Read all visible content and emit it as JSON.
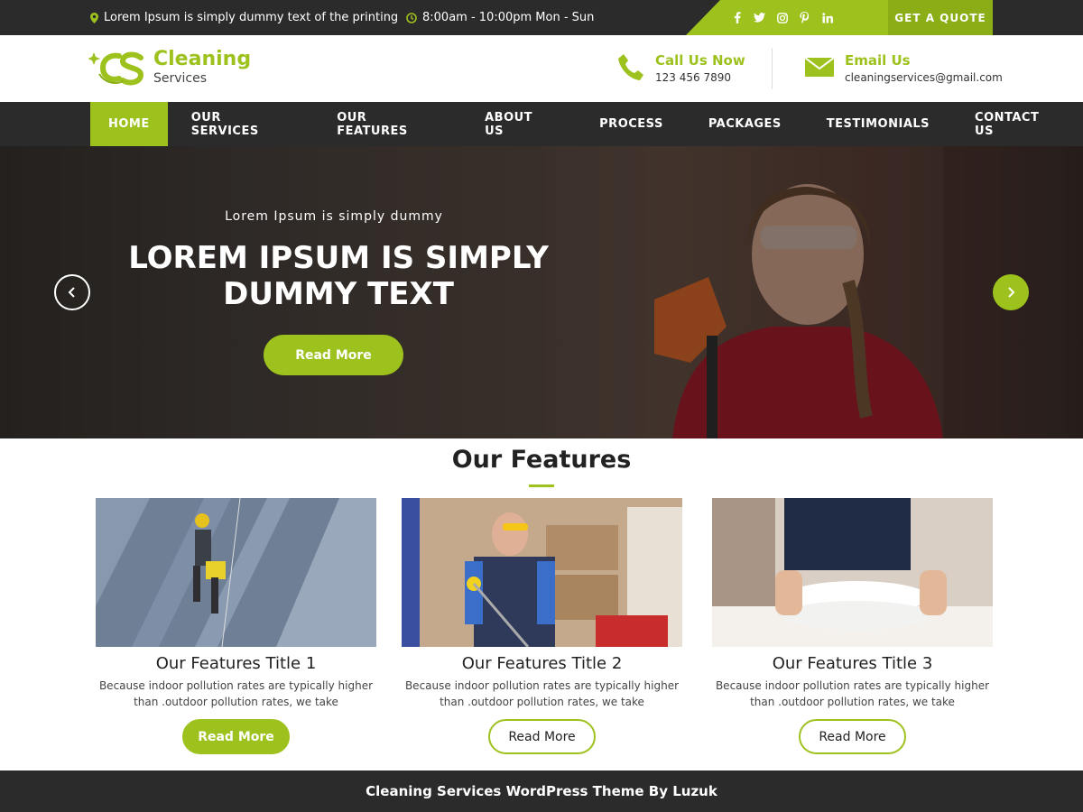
{
  "topbar": {
    "address": "Lorem Ipsum is simply dummy text of the printing",
    "hours": "8:00am - 10:00pm Mon - Sun",
    "social": [
      "facebook-icon",
      "twitter-icon",
      "instagram-icon",
      "pinterest-icon",
      "linkedin-icon"
    ],
    "quote_label": "GET A QUOTE"
  },
  "header": {
    "logo_line1": "Cleaning",
    "logo_line2": "Services",
    "call_title": "Call Us Now",
    "call_value": "123 456 7890",
    "email_title": "Email Us",
    "email_value": "cleaningservices@gmail.com"
  },
  "nav": {
    "items": [
      {
        "label": "HOME"
      },
      {
        "label": "OUR SERVICES"
      },
      {
        "label": "OUR FEATURES"
      },
      {
        "label": "ABOUT US"
      },
      {
        "label": "PROCESS"
      },
      {
        "label": "PACKAGES"
      },
      {
        "label": "TESTIMONIALS"
      },
      {
        "label": "CONTACT US"
      }
    ],
    "active": "HOME"
  },
  "hero": {
    "subtitle": "Lorem Ipsum is simply dummy",
    "title": "LOREM IPSUM IS SIMPLY DUMMY TEXT",
    "button": "Read More"
  },
  "features": {
    "heading": "Our Features",
    "cards": [
      {
        "title": "Our Features Title 1",
        "text": "Because indoor pollution rates are typically higher than .outdoor pollution rates, we take",
        "button": "Read More"
      },
      {
        "title": "Our Features Title 2",
        "text": "Because indoor pollution rates are typically higher than .outdoor pollution rates, we take",
        "button": "Read More"
      },
      {
        "title": "Our Features Title 3",
        "text": "Because indoor pollution rates are typically higher than .outdoor pollution rates, we take",
        "button": "Read More"
      }
    ]
  },
  "footer": {
    "text": "Cleaning Services WordPress Theme By Luzuk"
  },
  "colors": {
    "accent": "#9dc21e",
    "dark": "#2b2b2b"
  }
}
